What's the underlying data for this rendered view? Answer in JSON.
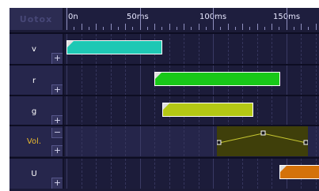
{
  "app_title": "Uotox",
  "ruler": {
    "labels": [
      "0n",
      "50ms",
      "100ms",
      "150ms"
    ]
  },
  "tracks": [
    {
      "name": "v",
      "note_color": "#1ec8b4"
    },
    {
      "name": "r",
      "note_color": "#18c818"
    },
    {
      "name": "g",
      "note_color": "#b4c814"
    },
    {
      "name": "Vol.",
      "envelope_line_color": "#c8c832"
    },
    {
      "name": "U",
      "note_color": "#d4720a"
    }
  ],
  "buttons": {
    "plus": "+",
    "minus": "−"
  }
}
